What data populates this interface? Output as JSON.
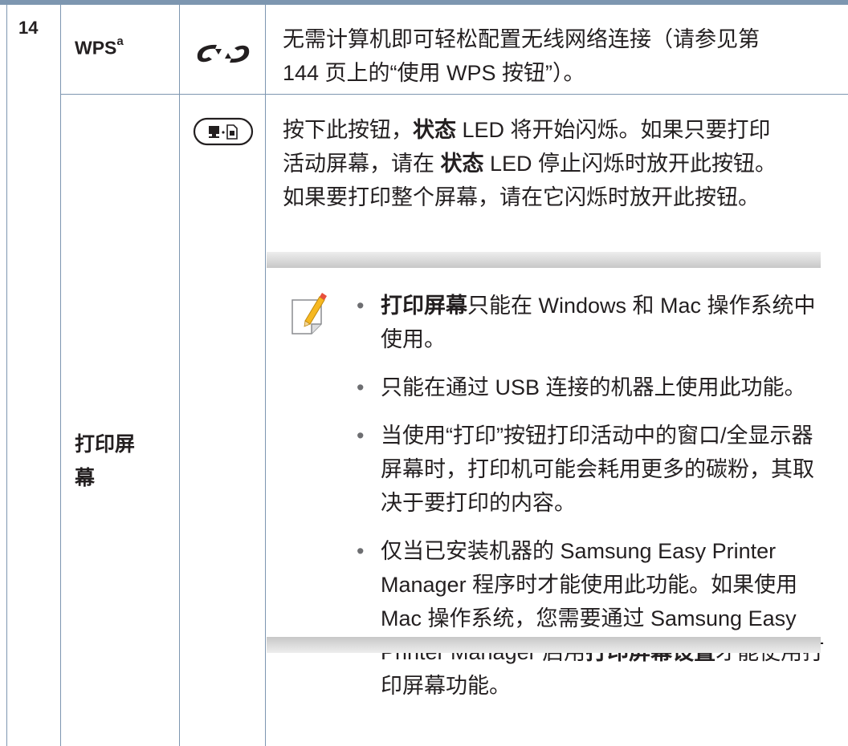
{
  "row14": {
    "number": "14",
    "name": "WPS",
    "name_sup": "a",
    "icon": "wps-icon",
    "desc_line1": "无需计算机即可轻松配置无线网络连接（请参见第",
    "desc_line2": "144 页上的“使用 WPS 按钮”）。"
  },
  "row_print_screen": {
    "name_line1": "打印屏",
    "name_line2": "幕",
    "icon": "print-screen-button-icon",
    "line1_a": "按下此按钮，",
    "line1_b": "状态",
    "line1_c": " LED 将开始闪烁。如果只要打印",
    "line2_a": "活动屏幕，请在 ",
    "line2_b": "状态",
    "line2_c": " LED 停止闪烁时放开此按钮。",
    "line3": "如果要打印整个屏幕，请在它闪烁时放开此按钮。"
  },
  "note": {
    "icon": "note-pencil-icon",
    "item1_bold": "打印屏幕",
    "item1_rest": "只能在 Windows 和 Mac 操作系统中使用。",
    "item2": "只能在通过 USB 连接的机器上使用此功能。",
    "item3": "当使用“打印”按钮打印活动中的窗口/全显示器屏幕时，打印机可能会耗用更多的碳粉，其取决于要打印的内容。",
    "item4_a": "仅当已安装机器的 Samsung Easy Printer Manager 程序时才能使用此功能。如果使用 Mac 操作系统，您需要通过 Samsung Easy Printer Manager 启用",
    "item4_bold": "打印屏幕设置",
    "item4_b": "才能使用打印屏幕功能。",
    "bullet": "•"
  },
  "colors": {
    "rule": "#7d96b0",
    "text": "#231f20"
  }
}
